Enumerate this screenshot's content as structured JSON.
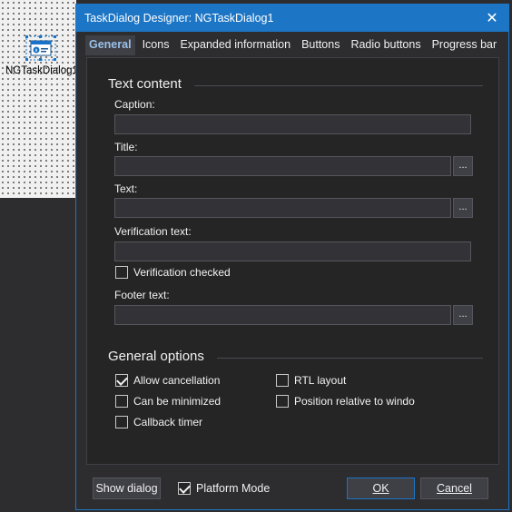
{
  "designer": {
    "component_label": "NGTaskDialog1"
  },
  "dialog": {
    "title": "TaskDialog Designer: NGTaskDialog1",
    "close_glyph": "✕",
    "tabs": [
      {
        "label": "General"
      },
      {
        "label": "Icons"
      },
      {
        "label": "Expanded information"
      },
      {
        "label": "Buttons"
      },
      {
        "label": "Radio buttons"
      },
      {
        "label": "Progress bar"
      }
    ],
    "text_content": {
      "header": "Text content",
      "caption_label": "Caption:",
      "caption_value": "",
      "title_label": "Title:",
      "title_value": "",
      "text_label": "Text:",
      "text_value": "",
      "verification_label": "Verification text:",
      "verification_value": "",
      "verification_checked_label": "Verification checked",
      "footer_label": "Footer text:",
      "footer_value": "",
      "ellipsis": "..."
    },
    "general_options": {
      "header": "General options",
      "allow_cancellation": "Allow cancellation",
      "can_be_minimized": "Can be minimized",
      "callback_timer": "Callback timer",
      "rtl_layout": "RTL layout",
      "position_relative": "Position relative to windo"
    },
    "footer": {
      "show_dialog": "Show dialog",
      "platform_mode": "Platform Mode",
      "ok": "OK",
      "cancel": "Cancel"
    }
  }
}
